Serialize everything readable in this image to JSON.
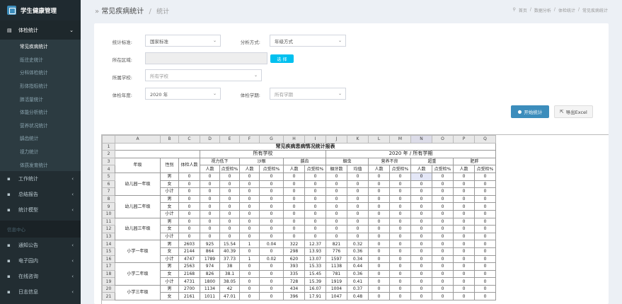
{
  "app": {
    "title": "学生健康管理"
  },
  "sidebar": {
    "group": {
      "label": "体检统计",
      "sub_items": [
        "常见疾病统计",
        "既往史统计",
        "分科体检统计",
        "形体指标统计",
        "肺活量统计",
        "体能分析统计",
        "营养状况统计",
        "龋齿统计",
        "视力统计",
        "体质发育统计"
      ],
      "active_index": 0
    },
    "menus": [
      {
        "label": "工作统计",
        "icon": "bar-chart-icon"
      },
      {
        "label": "总结报告",
        "icon": "file-icon"
      },
      {
        "label": "统计模型",
        "icon": "cubes-icon"
      }
    ],
    "section": "信息中心",
    "menus2": [
      {
        "label": "通知公告",
        "icon": "bullhorn-icon"
      },
      {
        "label": "电子园内",
        "icon": "folder-icon"
      },
      {
        "label": "在线咨询",
        "icon": "comment-icon"
      },
      {
        "label": "日志信息",
        "icon": "calendar-icon"
      }
    ]
  },
  "header": {
    "title": "常见疾病统计",
    "subtitle": "统计",
    "breadcrumb": [
      "首页",
      "数据分析",
      "体检统计",
      "常见疾病统计"
    ]
  },
  "form": {
    "stat_standard_label": "统计标准:",
    "stat_standard_value": "国家标准",
    "analysis_label": "分析方式:",
    "analysis_value": "年级方式",
    "region_label": "所在区域:",
    "region_value": "",
    "pick_button": "选 择",
    "school_label": "所属学校:",
    "school_value": "所有学校",
    "year_label": "体检年度:",
    "year_value": "2020 年",
    "term_label": "体检学期:",
    "term_value": "所有学期",
    "start_button": "开始统计",
    "export_button": "导出Excel"
  },
  "sheet": {
    "col_letters": [
      "A",
      "B",
      "C",
      "D",
      "E",
      "F",
      "G",
      "H",
      "I",
      "J",
      "K",
      "L",
      "M",
      "N",
      "O",
      "P",
      "Q"
    ],
    "title": "常见疾病患病情况统计报表",
    "school_header": "所有学校",
    "period_header": "2020 年 / 所有学期",
    "col_grade": "年级",
    "col_sex": "性别",
    "col_count": "体检人数",
    "groups": [
      "视力低下",
      "沙眼",
      "龋齿",
      "蛔虫",
      "营养不良",
      "超重",
      "肥胖"
    ],
    "sub_headers": [
      "人数",
      "点受检%",
      "人数",
      "点受检%",
      "人数",
      "点受检%",
      "蛔牙数",
      "均值",
      "人数",
      "点受检%",
      "人数",
      "点受检%",
      "人数",
      "点受检%"
    ],
    "grades": [
      "幼儿园一年级",
      "幼儿园二年级",
      "幼儿园三年级",
      "小学一年级",
      "小学二年级",
      "小学三年级"
    ],
    "rows": [
      [
        "男",
        "0",
        "0",
        "0",
        "0",
        "0",
        "0",
        "0",
        "0",
        "0",
        "0",
        "0",
        "0",
        "0",
        "0",
        "0"
      ],
      [
        "女",
        "0",
        "0",
        "0",
        "0",
        "0",
        "0",
        "0",
        "0",
        "0",
        "0",
        "0",
        "0",
        "0",
        "0",
        "0"
      ],
      [
        "小计",
        "0",
        "0",
        "0",
        "0",
        "0",
        "0",
        "0",
        "0",
        "0",
        "0",
        "0",
        "0",
        "0",
        "0",
        "0"
      ],
      [
        "男",
        "0",
        "0",
        "0",
        "0",
        "0",
        "0",
        "0",
        "0",
        "0",
        "0",
        "0",
        "0",
        "0",
        "0",
        "0"
      ],
      [
        "女",
        "0",
        "0",
        "0",
        "0",
        "0",
        "0",
        "0",
        "0",
        "0",
        "0",
        "0",
        "0",
        "0",
        "0",
        "0"
      ],
      [
        "小计",
        "0",
        "0",
        "0",
        "0",
        "0",
        "0",
        "0",
        "0",
        "0",
        "0",
        "0",
        "0",
        "0",
        "0",
        "0"
      ],
      [
        "男",
        "0",
        "0",
        "0",
        "0",
        "0",
        "0",
        "0",
        "0",
        "0",
        "0",
        "0",
        "0",
        "0",
        "0",
        "0"
      ],
      [
        "女",
        "0",
        "0",
        "0",
        "0",
        "0",
        "0",
        "0",
        "0",
        "0",
        "0",
        "0",
        "0",
        "0",
        "0",
        "0"
      ],
      [
        "小计",
        "0",
        "0",
        "0",
        "0",
        "0",
        "0",
        "0",
        "0",
        "0",
        "0",
        "0",
        "0",
        "0",
        "0",
        "0"
      ],
      [
        "男",
        "2603",
        "925",
        "15.54",
        "1",
        "0.04",
        "322",
        "12.37",
        "821",
        "0.32",
        "0",
        "0",
        "0",
        "0",
        "0",
        "0"
      ],
      [
        "女",
        "2144",
        "864",
        "40.39",
        "0",
        "0",
        "298",
        "13.93",
        "776",
        "0.36",
        "0",
        "0",
        "0",
        "0",
        "0",
        "0"
      ],
      [
        "小计",
        "4747",
        "1789",
        "37.73",
        "1",
        "0.02",
        "620",
        "13.07",
        "1597",
        "0.34",
        "0",
        "0",
        "0",
        "0",
        "0",
        "0"
      ],
      [
        "男",
        "2563",
        "974",
        "38",
        "0",
        "0",
        "393",
        "15.33",
        "1138",
        "0.44",
        "0",
        "0",
        "0",
        "0",
        "0",
        "0"
      ],
      [
        "女",
        "2168",
        "826",
        "38.1",
        "0",
        "0",
        "335",
        "15.45",
        "781",
        "0.36",
        "0",
        "0",
        "0",
        "0",
        "0",
        "0"
      ],
      [
        "小计",
        "4731",
        "1800",
        "38.05",
        "0",
        "0",
        "728",
        "15.39",
        "1919",
        "0.41",
        "0",
        "0",
        "0",
        "0",
        "0",
        "0"
      ],
      [
        "男",
        "2700",
        "1134",
        "42",
        "0",
        "0",
        "434",
        "16.07",
        "1004",
        "0.37",
        "0",
        "0",
        "0",
        "0",
        "0",
        "0"
      ],
      [
        "女",
        "2161",
        "1011",
        "47.01",
        "0",
        "0",
        "396",
        "17.91",
        "1047",
        "0.48",
        "0",
        "0",
        "0",
        "0",
        "0",
        "0"
      ]
    ]
  }
}
